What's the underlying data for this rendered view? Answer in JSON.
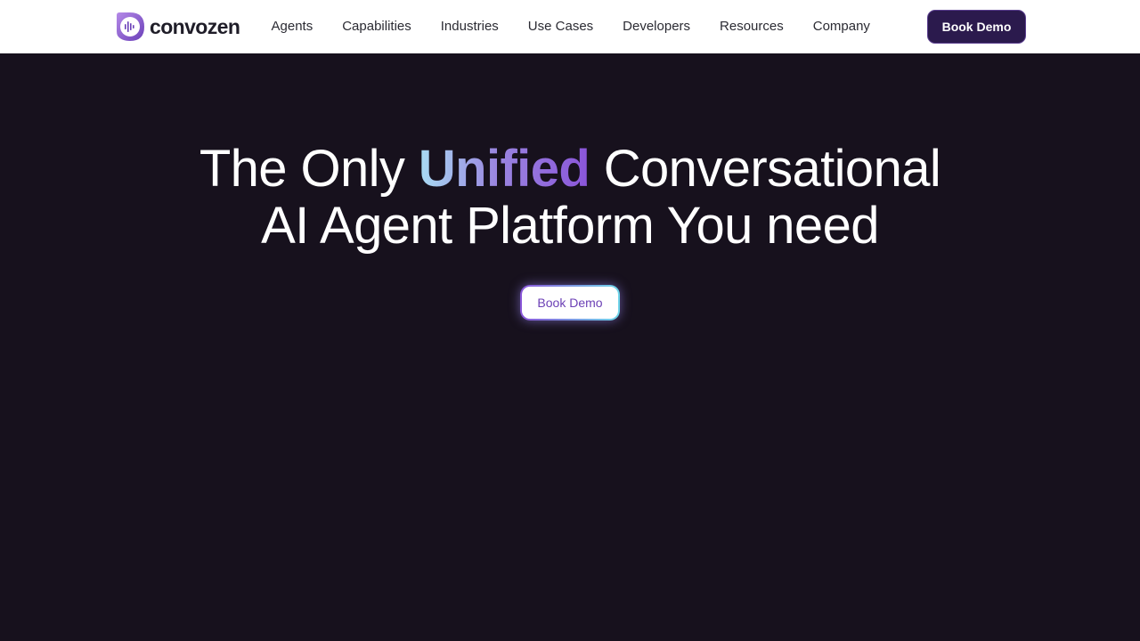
{
  "brand": {
    "name": "convozen",
    "logo_icon": "waveform-shield-icon",
    "logo_colors": [
      "#a06be0",
      "#6a3fb8"
    ]
  },
  "nav": {
    "links": [
      {
        "label": "Agents"
      },
      {
        "label": "Capabilities"
      },
      {
        "label": "Industries"
      },
      {
        "label": "Use Cases"
      },
      {
        "label": "Developers"
      },
      {
        "label": "Resources"
      },
      {
        "label": "Company"
      }
    ],
    "cta_label": "Book Demo"
  },
  "hero": {
    "title_prefix": "The Only ",
    "title_highlight": "Unified",
    "title_suffix": " Conversational",
    "title_line2": "AI Agent Platform You need",
    "cta_label": "Book Demo"
  },
  "colors": {
    "nav_bg": "#ffffff",
    "hero_bg": "#17111d",
    "cta_bg": "#2b1a4d",
    "highlight_gradient": [
      "#a9dcf3",
      "#9a86e0",
      "#8a55d9"
    ],
    "hero_cta_text": "#6b3fb5"
  }
}
